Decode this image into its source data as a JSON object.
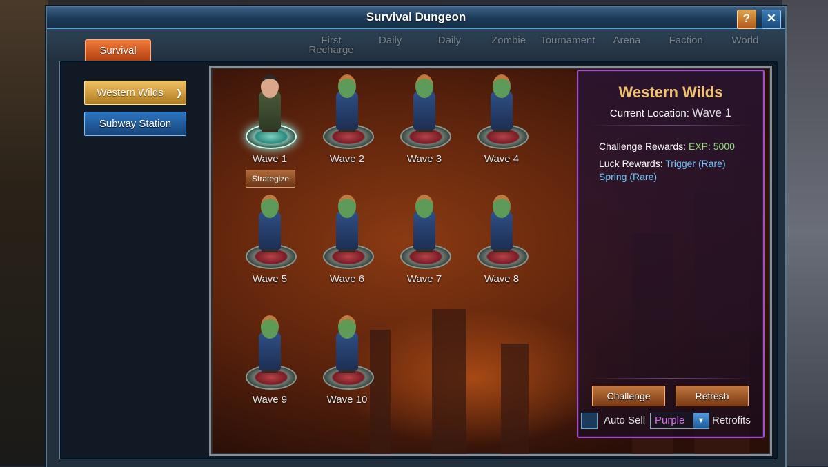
{
  "background_menu": [
    "First Recharge",
    "Daily",
    "Daily",
    "Zombie",
    "Tournament",
    "Arena",
    "Faction",
    "World"
  ],
  "window": {
    "title": "Survival Dungeon",
    "help_label": "?",
    "close_label": "✕"
  },
  "tabs": {
    "survival": "Survival"
  },
  "zones": [
    {
      "label": "Western Wilds",
      "active": true
    },
    {
      "label": "Subway Station",
      "active": false
    }
  ],
  "waves": [
    {
      "label": "Wave 1",
      "status": "current"
    },
    {
      "label": "Wave 2",
      "status": "locked"
    },
    {
      "label": "Wave 3",
      "status": "locked"
    },
    {
      "label": "Wave 4",
      "status": "locked"
    },
    {
      "label": "Wave 5",
      "status": "locked"
    },
    {
      "label": "Wave 6",
      "status": "locked"
    },
    {
      "label": "Wave 7",
      "status": "locked"
    },
    {
      "label": "Wave 8",
      "status": "locked"
    },
    {
      "label": "Wave 9",
      "status": "locked"
    },
    {
      "label": "Wave 10",
      "status": "locked"
    }
  ],
  "strategize_label": "Strategize",
  "info": {
    "zone_name": "Western Wilds",
    "current_location_label": "Current Location:",
    "current_location_value": "Wave 1",
    "challenge_rewards_label": "Challenge Rewards:",
    "challenge_rewards_value": "EXP: 5000",
    "luck_rewards_label": "Luck Rewards:",
    "luck_rewards_item1": "Trigger (Rare)",
    "luck_rewards_item2": "Spring (Rare)",
    "challenge_button": "Challenge",
    "refresh_button": "Refresh",
    "auto_sell_label": "Auto Sell",
    "auto_sell_checked": false,
    "auto_sell_select_value": "Purple",
    "retrofits_label": "Retrofits"
  },
  "colors": {
    "zone_name": "#f0c070",
    "green_text": "#8ee07a",
    "cyan_text": "#6ec8ff",
    "purple_select": "#d873e8",
    "info_border": "#a050c8"
  }
}
